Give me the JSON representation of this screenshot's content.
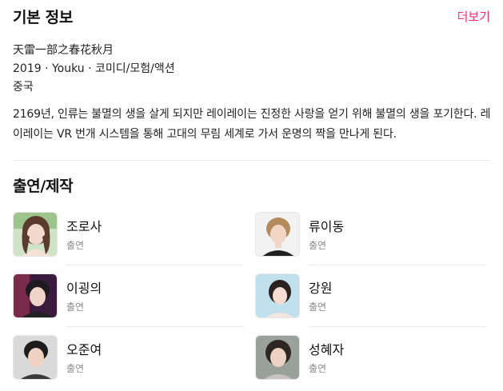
{
  "section": {
    "title": "기본 정보",
    "more_label": "더보기"
  },
  "info": {
    "original_title": "天雷一部之春花秋月",
    "meta": "2019 · Youku · 코미디/모험/액션",
    "country": "중국"
  },
  "description": "2169년, 인류는 불멸의 생을 살게 되지만 레이레이는 진정한 사랑을 얻기 위해 불멸의 생을 포기한다. 레이레이는 VR 번개 시스템을 통해 고대의 무림 세계로 가서 운명의 짝을 만나게 된다.",
  "cast": {
    "title": "출연/제작",
    "people": [
      {
        "name": "조로사",
        "role": "출연"
      },
      {
        "name": "류이동",
        "role": "출연"
      },
      {
        "name": "이굉의",
        "role": "출연"
      },
      {
        "name": "강원",
        "role": "출연"
      },
      {
        "name": "오준여",
        "role": "출연"
      },
      {
        "name": "성혜자",
        "role": "출연"
      }
    ]
  },
  "colors": {
    "accent": "#ff2d6f",
    "text": "#111111",
    "muted": "#8c8c8c",
    "divider": "#ebebeb"
  }
}
